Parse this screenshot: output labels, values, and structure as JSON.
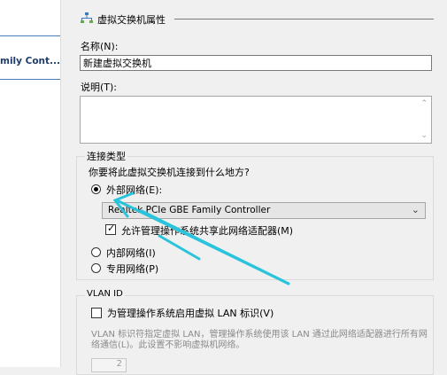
{
  "left_pane": {
    "item_label": "mily Cont..."
  },
  "properties": {
    "header": "虚拟交换机属性",
    "name_label": "名称(N):",
    "name_value": "新建虚拟交换机",
    "notes_label": "说明(T):",
    "notes_value": ""
  },
  "connection": {
    "group_title": "连接类型",
    "question": "你要将此虚拟交换机连接到什么地方?",
    "external_label": "外部网络(E):",
    "external_checked": true,
    "adapter_selected": "Realtek PCIe GBE Family Controller",
    "share_label": "允许管理操作系统共享此网络适配器(M)",
    "share_checked": true,
    "internal_label": "内部网络(I)",
    "private_label": "专用网络(P)"
  },
  "vlan": {
    "group_title": "VLAN ID",
    "enable_label": "为管理操作系统启用虚拟 LAN 标识(V)",
    "description": "VLAN 标识符指定虚拟 LAN，管理操作系统使用该 LAN 通过此网络适配器进行所有网络通信(L)。此设置不影响虚拟机网络。",
    "id_value": "2"
  },
  "icons": {
    "switch": "network-switch-icon",
    "dropdown": "chevron-down-icon",
    "scroll_up": "chevron-up-icon",
    "scroll_down": "chevron-down-icon",
    "annotation": "arrow-annotation-icon"
  },
  "colors": {
    "annotation": "#29c4dc",
    "selection_rule": "#4a7db8",
    "switch_icon": "#3a78c2"
  }
}
